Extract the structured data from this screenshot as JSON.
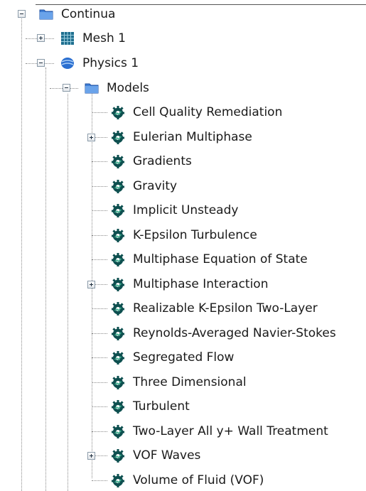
{
  "tree": {
    "root": {
      "label": "Continua",
      "icon": "folder-icon",
      "expanded": true
    },
    "mesh": {
      "label": "Mesh 1",
      "icon": "mesh-grid-icon",
      "expanded": false
    },
    "physics": {
      "label": "Physics 1",
      "icon": "physics-icon",
      "expanded": true
    },
    "models": {
      "label": "Models",
      "icon": "folder-icon",
      "expanded": true
    },
    "model_items": [
      {
        "label": "Cell Quality Remediation",
        "icon": "model-gear-icon",
        "expandable": false
      },
      {
        "label": "Eulerian Multiphase",
        "icon": "model-gear-icon",
        "expandable": true
      },
      {
        "label": "Gradients",
        "icon": "model-gear-icon",
        "expandable": false
      },
      {
        "label": "Gravity",
        "icon": "model-gear-icon",
        "expandable": false
      },
      {
        "label": "Implicit Unsteady",
        "icon": "model-gear-icon",
        "expandable": false
      },
      {
        "label": "K-Epsilon Turbulence",
        "icon": "model-gear-icon",
        "expandable": false
      },
      {
        "label": "Multiphase Equation of State",
        "icon": "model-gear-icon",
        "expandable": false
      },
      {
        "label": "Multiphase Interaction",
        "icon": "model-gear-icon",
        "expandable": true
      },
      {
        "label": "Realizable K-Epsilon Two-Layer",
        "icon": "model-gear-icon",
        "expandable": false
      },
      {
        "label": "Reynolds-Averaged Navier-Stokes",
        "icon": "model-gear-icon",
        "expandable": false
      },
      {
        "label": "Segregated Flow",
        "icon": "model-gear-icon",
        "expandable": false
      },
      {
        "label": "Three Dimensional",
        "icon": "model-gear-icon",
        "expandable": false
      },
      {
        "label": "Turbulent",
        "icon": "model-gear-icon",
        "expandable": false
      },
      {
        "label": "Two-Layer All y+ Wall Treatment",
        "icon": "model-gear-icon",
        "expandable": false
      },
      {
        "label": "VOF Waves",
        "icon": "model-gear-icon",
        "expandable": true
      },
      {
        "label": "Volume of Fluid (VOF)",
        "icon": "model-gear-icon",
        "expandable": false
      }
    ]
  },
  "colors": {
    "folder": "#3f7fd6",
    "mesh": "#1f6f8f",
    "physics": "#2b6fd0",
    "model_gear": "#0d4f4f",
    "tree_line": "#8a8a8a"
  }
}
